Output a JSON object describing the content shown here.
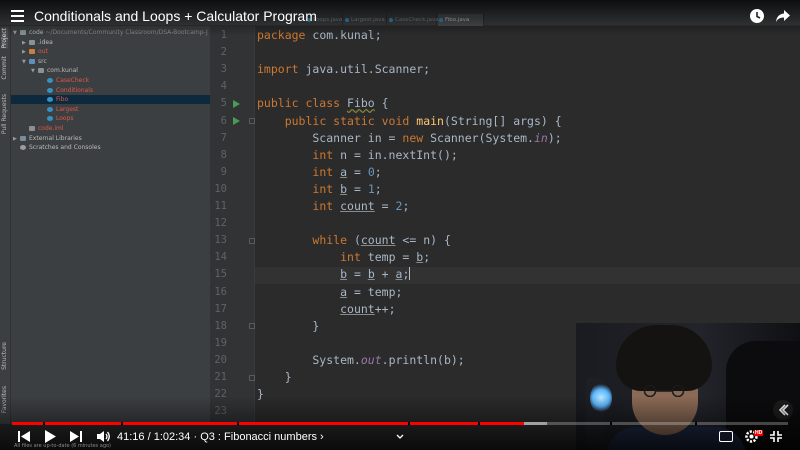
{
  "youtube": {
    "video_title": "Conditionals and Loops + Calculator Program",
    "time_display": "41:16 / 1:02:34",
    "chapter": "Q3 : Fibonacci numbers",
    "hd_badge": "HD",
    "progress_fraction": 0.66,
    "loaded_fraction": 0.69,
    "chapter_marks": [
      0.04,
      0.14,
      0.29,
      0.51,
      0.6,
      0.77,
      0.88
    ],
    "icons": [
      "menu-icon",
      "watch-later-icon",
      "share-icon",
      "skip-previous-icon",
      "play-icon",
      "skip-next-icon",
      "volume-icon",
      "chevron-right-icon",
      "chevron-down-icon",
      "subtitles-icon",
      "settings-icon",
      "fullscreen-icon",
      "collapse-icon"
    ]
  },
  "ide": {
    "breadcrumb": [
      "code",
      "src",
      "com",
      "kunal",
      "Fibo",
      "main"
    ],
    "run_config": "CaseCheck",
    "tabs": [
      "Loops.java",
      "Largest.java",
      "CaseCheck.java",
      "Fibo.java"
    ],
    "active_tab": "Fibo.java",
    "sidebar_tabs": [
      "Project",
      "Commit",
      "Pull Requests",
      "Structure",
      "Favorites"
    ],
    "tree": [
      {
        "depth": 0,
        "label": "code",
        "suffix": "~/Documents/Community Classroom/DSA-Bootcamp-J",
        "icon": "ic-folder",
        "arrow": "down"
      },
      {
        "depth": 1,
        "label": ".idea",
        "icon": "ic-folder",
        "arrow": "right"
      },
      {
        "depth": 1,
        "label": "out",
        "icon": "ic-folder-orange",
        "arrow": "right",
        "color": "t-red"
      },
      {
        "depth": 1,
        "label": "src",
        "icon": "ic-folder-blue",
        "arrow": "down"
      },
      {
        "depth": 2,
        "label": "com.kunal",
        "icon": "ic-folder",
        "arrow": "down"
      },
      {
        "depth": 3,
        "label": "CaseCheck",
        "icon": "ic-class",
        "color": "t-red"
      },
      {
        "depth": 3,
        "label": "Conditionals",
        "icon": "ic-class",
        "color": "t-red"
      },
      {
        "depth": 3,
        "label": "Fibo",
        "icon": "ic-class",
        "color": "t-red",
        "selected": true
      },
      {
        "depth": 3,
        "label": "Largest",
        "icon": "ic-class",
        "color": "t-red"
      },
      {
        "depth": 3,
        "label": "Loops",
        "icon": "ic-class",
        "color": "t-red"
      },
      {
        "depth": 1,
        "label": "code.iml",
        "icon": "ic-iml",
        "color": "t-red"
      },
      {
        "depth": 0,
        "label": "External Libraries",
        "icon": "ic-lib",
        "arrow": "right"
      },
      {
        "depth": 0,
        "label": "Scratches and Consoles",
        "icon": "ic-scratch"
      }
    ],
    "code_lines": [
      {
        "n": 1,
        "html": "<span class=\"kw\">package</span> com.kunal;"
      },
      {
        "n": 2,
        "html": ""
      },
      {
        "n": 3,
        "html": "<span class=\"kw\">import</span> java.util.Scanner;"
      },
      {
        "n": 4,
        "html": ""
      },
      {
        "n": 5,
        "html": "<span class=\"kw\">public class</span> <span class=\"squig\">Fibo</span> {",
        "run": true
      },
      {
        "n": 6,
        "html": "    <span class=\"kw\">public static void</span> <span class=\"fn\">main</span>(String[] args) {",
        "run": true,
        "fold": true
      },
      {
        "n": 7,
        "html": "        Scanner in = <span class=\"kw\">new</span> Scanner(System.<span class=\"it\">in</span>);"
      },
      {
        "n": 8,
        "html": "        <span class=\"kw\">int</span> n = in.nextInt();"
      },
      {
        "n": 9,
        "html": "        <span class=\"kw\">int</span> <span class=\"ul\">a</span> = <span class=\"num\">0</span>;"
      },
      {
        "n": 10,
        "html": "        <span class=\"kw\">int</span> <span class=\"ul\">b</span> = <span class=\"num\">1</span>;"
      },
      {
        "n": 11,
        "html": "        <span class=\"kw\">int</span> <span class=\"ul\">count</span> = <span class=\"num\">2</span>;"
      },
      {
        "n": 12,
        "html": ""
      },
      {
        "n": 13,
        "html": "        <span class=\"kw\">while</span> (<span class=\"ul\">count</span> &lt;= n) {",
        "fold": true
      },
      {
        "n": 14,
        "html": "            <span class=\"kw\">int</span> temp = <span class=\"ul\">b</span>;"
      },
      {
        "n": 15,
        "html": "            <span class=\"ul\">b</span> = <span class=\"ul\">b</span> + <span class=\"ul\">a</span>;<span class=\"caret\"></span>",
        "current": true
      },
      {
        "n": 16,
        "html": "            <span class=\"ul\">a</span> = temp;"
      },
      {
        "n": 17,
        "html": "            <span class=\"ul\">count</span>++;"
      },
      {
        "n": 18,
        "html": "        }",
        "fold": true
      },
      {
        "n": 19,
        "html": ""
      },
      {
        "n": 20,
        "html": "        System.<span class=\"it\">out</span>.println(b);"
      },
      {
        "n": 21,
        "html": "    }",
        "fold": true
      },
      {
        "n": 22,
        "html": "}"
      },
      {
        "n": 23,
        "html": ""
      }
    ],
    "status_bar": "All files are up-to-date (6 minutes ago)"
  }
}
